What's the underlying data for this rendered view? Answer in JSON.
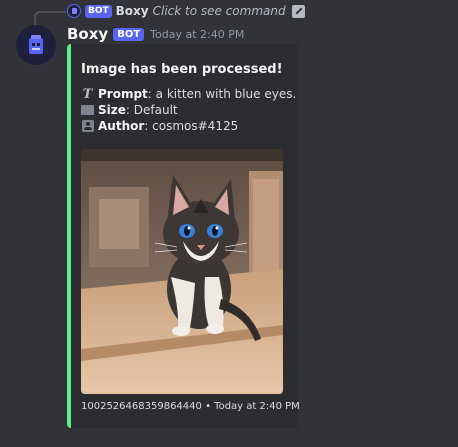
{
  "reply": {
    "bot_tag": "BOT",
    "author": "Boxy",
    "command_text": "Click to see command",
    "command_icon": "slash-command-icon"
  },
  "message": {
    "author": "Boxy",
    "bot_tag": "BOT",
    "timestamp": "Today at 2:40 PM",
    "avatar_icon": "robot-box-icon"
  },
  "embed": {
    "accent_color": "#57f287",
    "title": "Image has been processed!",
    "fields": [
      {
        "icon": "text-prompt-icon",
        "label": "Prompt",
        "sep": ":",
        "value": "a kitten with blue eyes."
      },
      {
        "icon": "image-size-icon",
        "label": "Size",
        "sep": ":",
        "value": "Default"
      },
      {
        "icon": "author-card-icon",
        "label": "Author",
        "sep": ":",
        "value": "cosmos#4125"
      }
    ],
    "image_icon": "kitten-image",
    "footer": {
      "id": "1002526468359864440",
      "separator": "•",
      "timestamp": "Today at 2:40 PM"
    }
  },
  "colors": {
    "background": "#313338",
    "embed_background": "#2b2d31",
    "bot_tag": "#5865f2"
  }
}
